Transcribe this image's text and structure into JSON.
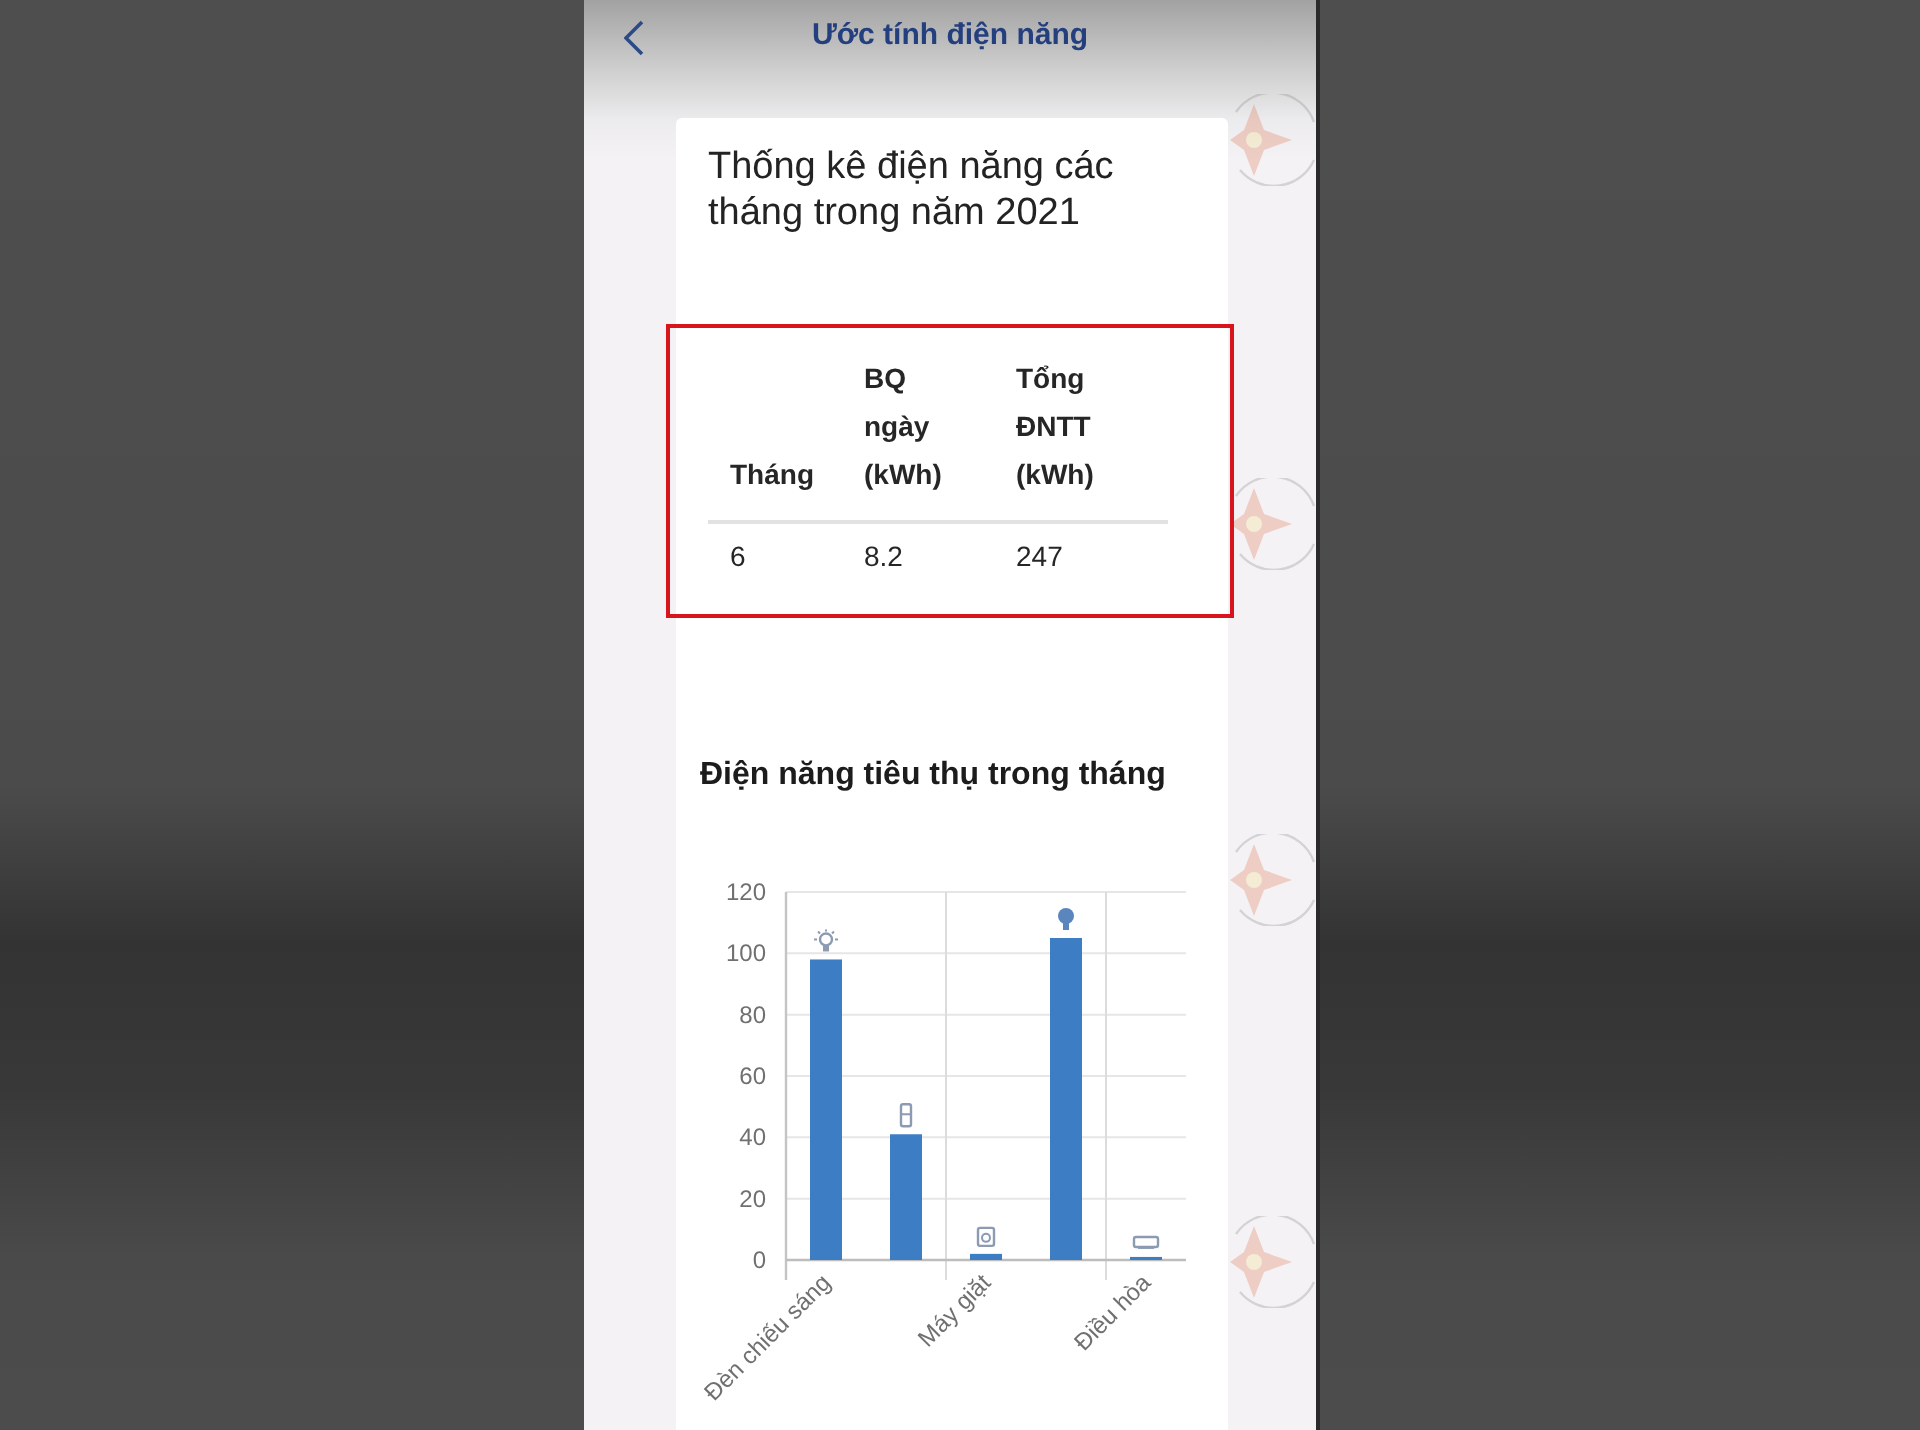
{
  "header": {
    "title": "Ước tính điện năng"
  },
  "summary": {
    "title": "Thống kê điện năng các tháng trong năm 2021",
    "table": {
      "columns": [
        "Tháng",
        "BQ ngày (kWh)",
        "Tổng ĐNTT (kWh)"
      ],
      "rows": [
        [
          "6",
          "8.2",
          "247"
        ]
      ]
    }
  },
  "consumption": {
    "title": "Điện năng tiêu thụ trong tháng",
    "chart_data": {
      "type": "bar",
      "categories": [
        "Đèn chiếu sáng",
        null,
        "Máy giặt",
        null,
        "Điều hòa"
      ],
      "values": [
        98,
        41,
        2,
        105,
        1
      ],
      "ylim": [
        0,
        120
      ],
      "yticks": [
        0,
        20,
        40,
        60,
        80,
        100,
        120
      ],
      "grid": true
    }
  }
}
